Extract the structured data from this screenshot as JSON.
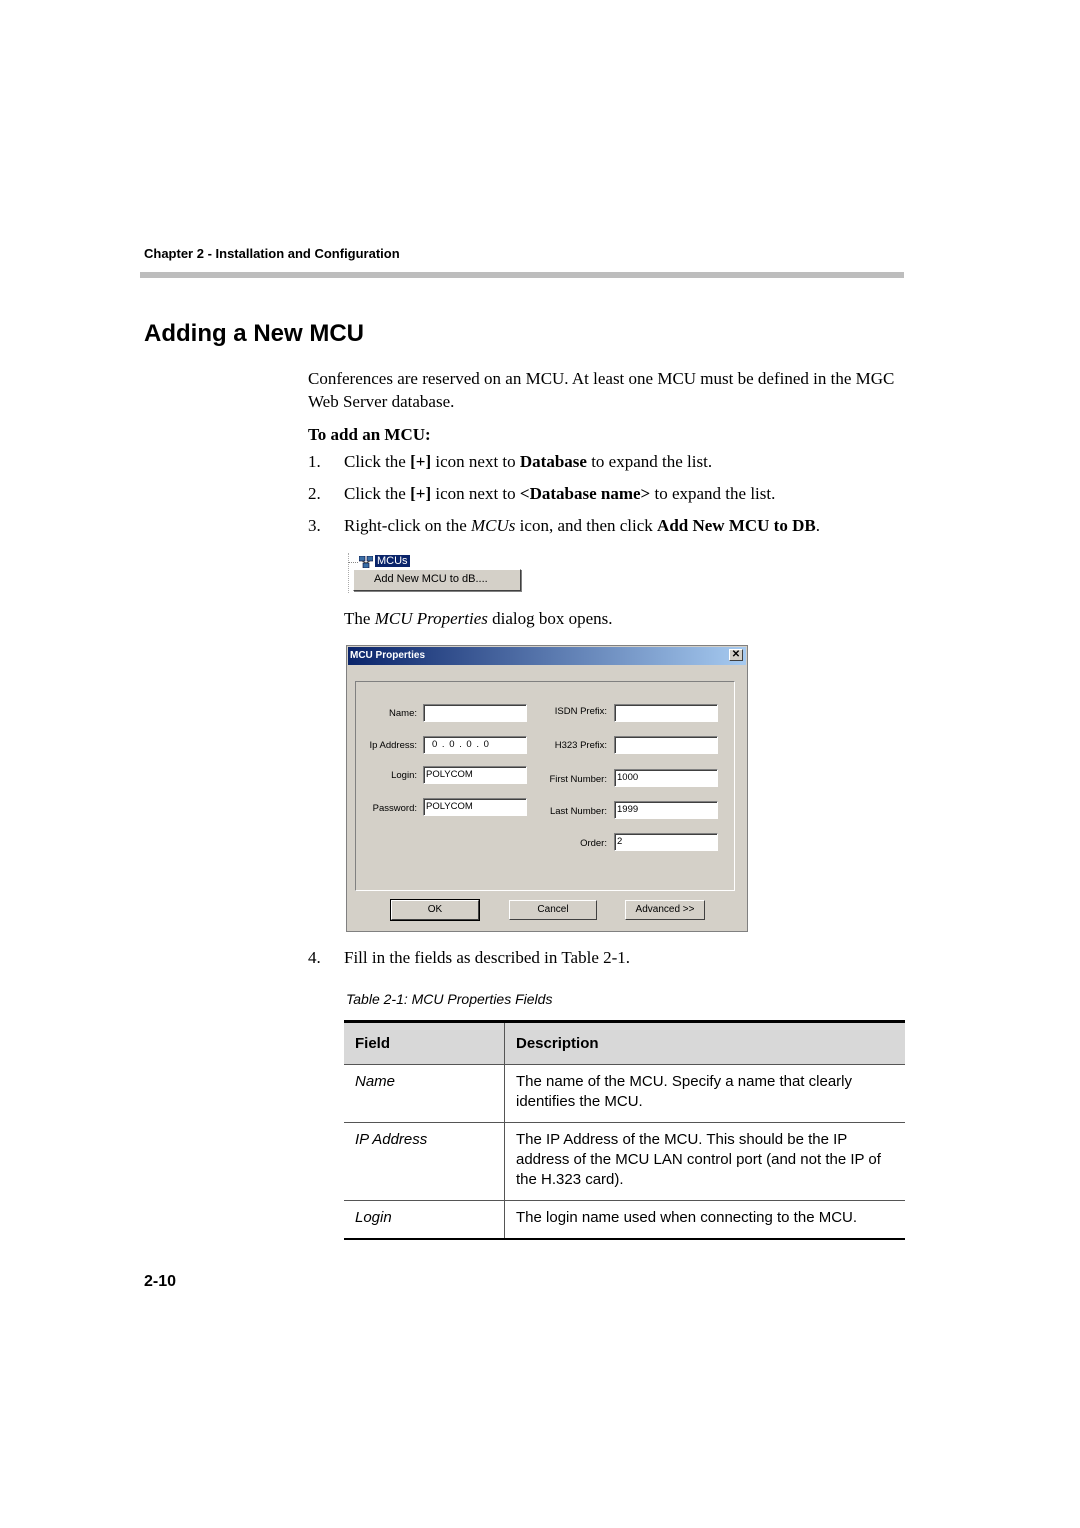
{
  "header": {
    "chapter": "Chapter 2 - Installation and Configuration"
  },
  "section": {
    "title": "Adding a New MCU",
    "intro": "Conferences are reserved on an MCU. At least one MCU must be defined in the MGC Web Server database.",
    "procedure_title": "To add an MCU:",
    "steps": [
      {
        "num": "1.",
        "pre": "Click the ",
        "b1": "[+]",
        "mid": " icon next to ",
        "b2": "Database",
        "post": " to expand the list."
      },
      {
        "num": "2.",
        "pre": "Click the ",
        "b1": "[+]",
        "mid": " icon next to ",
        "b2": "<Database name>",
        "post": " to expand the list."
      },
      {
        "num": "3.",
        "pre": "Right-click on the ",
        "i1": "MCUs",
        "mid": " icon, and then click ",
        "b2": "Add New MCU to DB",
        "post": "."
      },
      {
        "num": "4.",
        "text": "Fill in the fields as described in Table 2-1."
      }
    ],
    "dialog_opens": {
      "pre": "The ",
      "i1": "MCU Properties",
      "post": " dialog box opens."
    }
  },
  "context_menu": {
    "tree_item": "MCUs",
    "menu_item": "Add New MCU to dB...."
  },
  "dialog": {
    "title": "MCU Properties",
    "close": "✕",
    "left_fields": [
      {
        "label": "Name:",
        "value": ""
      },
      {
        "label": "Ip Address:",
        "value": "0 . 0 . 0 . 0"
      },
      {
        "label": "Login:",
        "value": "POLYCOM"
      },
      {
        "label": "Password:",
        "value": "POLYCOM"
      }
    ],
    "right_fields": [
      {
        "label": "ISDN Prefix:",
        "value": ""
      },
      {
        "label": "H323 Prefix:",
        "value": ""
      },
      {
        "label": "First Number:",
        "value": "1000"
      },
      {
        "label": "Last Number:",
        "value": "1999"
      },
      {
        "label": "Order:",
        "value": "2"
      }
    ],
    "buttons": {
      "ok": "OK",
      "cancel": "Cancel",
      "advanced": "Advanced >>"
    }
  },
  "table": {
    "caption": "Table 2-1: MCU Properties Fields",
    "headers": [
      "Field",
      "Description"
    ],
    "rows": [
      {
        "field": "Name",
        "description": "The name of the MCU. Specify a name that clearly identifies the MCU."
      },
      {
        "field": "IP Address",
        "description": "The IP Address of the MCU. This should be the IP address of the MCU LAN control port (and not the IP of the H.323 card)."
      },
      {
        "field": "Login",
        "description": "The login name used when connecting to the MCU."
      }
    ]
  },
  "footer": {
    "page_number": "2-10"
  }
}
